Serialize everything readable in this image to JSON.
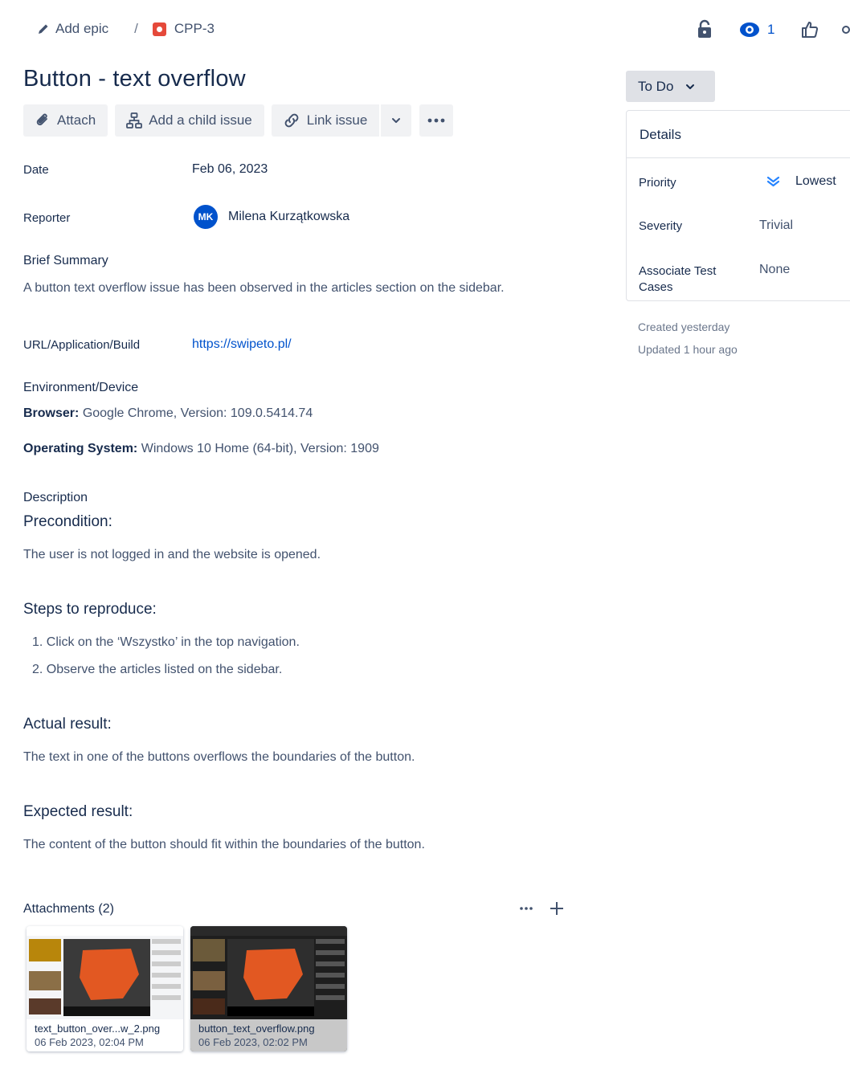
{
  "breadcrumb": {
    "add_epic": "Add epic",
    "separator": "/",
    "issue_key": "CPP-3"
  },
  "top_actions": {
    "watchers_count": "1"
  },
  "issue": {
    "title": "Button - text overflow"
  },
  "toolbar": {
    "attach": "Attach",
    "add_child": "Add a child issue",
    "link_issue": "Link issue"
  },
  "fields": {
    "date_label": "Date",
    "date_value": "Feb 06, 2023",
    "reporter_label": "Reporter",
    "reporter_initials": "MK",
    "reporter_name": "Milena Kurzątkowska",
    "brief_summary_label": "Brief Summary",
    "brief_summary": "A button text overflow issue has been observed in the articles section on the sidebar.",
    "url_label": "URL/Application/Build",
    "url_value": "https://swipeto.pl/",
    "env_label": "Environment/Device",
    "browser_label": "Browser:",
    "browser_value": "Google Chrome, Version: 109.0.5414.74",
    "os_label": "Operating System:",
    "os_value": "Windows 10 Home (64-bit), Version: 1909"
  },
  "description": {
    "label": "Description",
    "precondition_heading": "Precondition:",
    "precondition": "The user is not logged in and the website is opened.",
    "steps_heading": "Steps to reproduce:",
    "steps": [
      "1. Click on the ‘Wszystko’ in the top navigation.",
      "2. Observe the articles listed on the sidebar."
    ],
    "actual_heading": "Actual result:",
    "actual": "The text in one of the buttons overflows the boundaries of the button.",
    "expected_heading": "Expected result:",
    "expected": "The content of the button should fit within the boundaries of the button."
  },
  "attachments": {
    "heading": "Attachments (2)",
    "items": [
      {
        "name": "text_button_over...w_2.png",
        "date": "06 Feb 2023, 02:04 PM"
      },
      {
        "name": "button_text_overflow.png",
        "date": "06 Feb 2023, 02:02 PM"
      }
    ]
  },
  "sidebar": {
    "status": "To Do",
    "details_heading": "Details",
    "priority_label": "Priority",
    "priority_value": "Lowest",
    "severity_label": "Severity",
    "severity_value": "Trivial",
    "assoc_label_1": "Associate Test",
    "assoc_label_2": "Cases",
    "assoc_value": "None",
    "created": "Created yesterday",
    "updated": "Updated 1 hour ago"
  },
  "colors": {
    "link": "#0052cc",
    "priority_lowest": "#2684ff",
    "bug": "#e5493a",
    "avatar": "#0052cc"
  },
  "icons": [
    "pencil-icon",
    "bug-icon",
    "lock-icon",
    "eye-icon",
    "thumbs-up-icon",
    "paperclip-icon",
    "child-issue-icon",
    "link-icon",
    "chevron-down-icon",
    "more-icon",
    "plus-icon",
    "priority-lowest-icon"
  ]
}
